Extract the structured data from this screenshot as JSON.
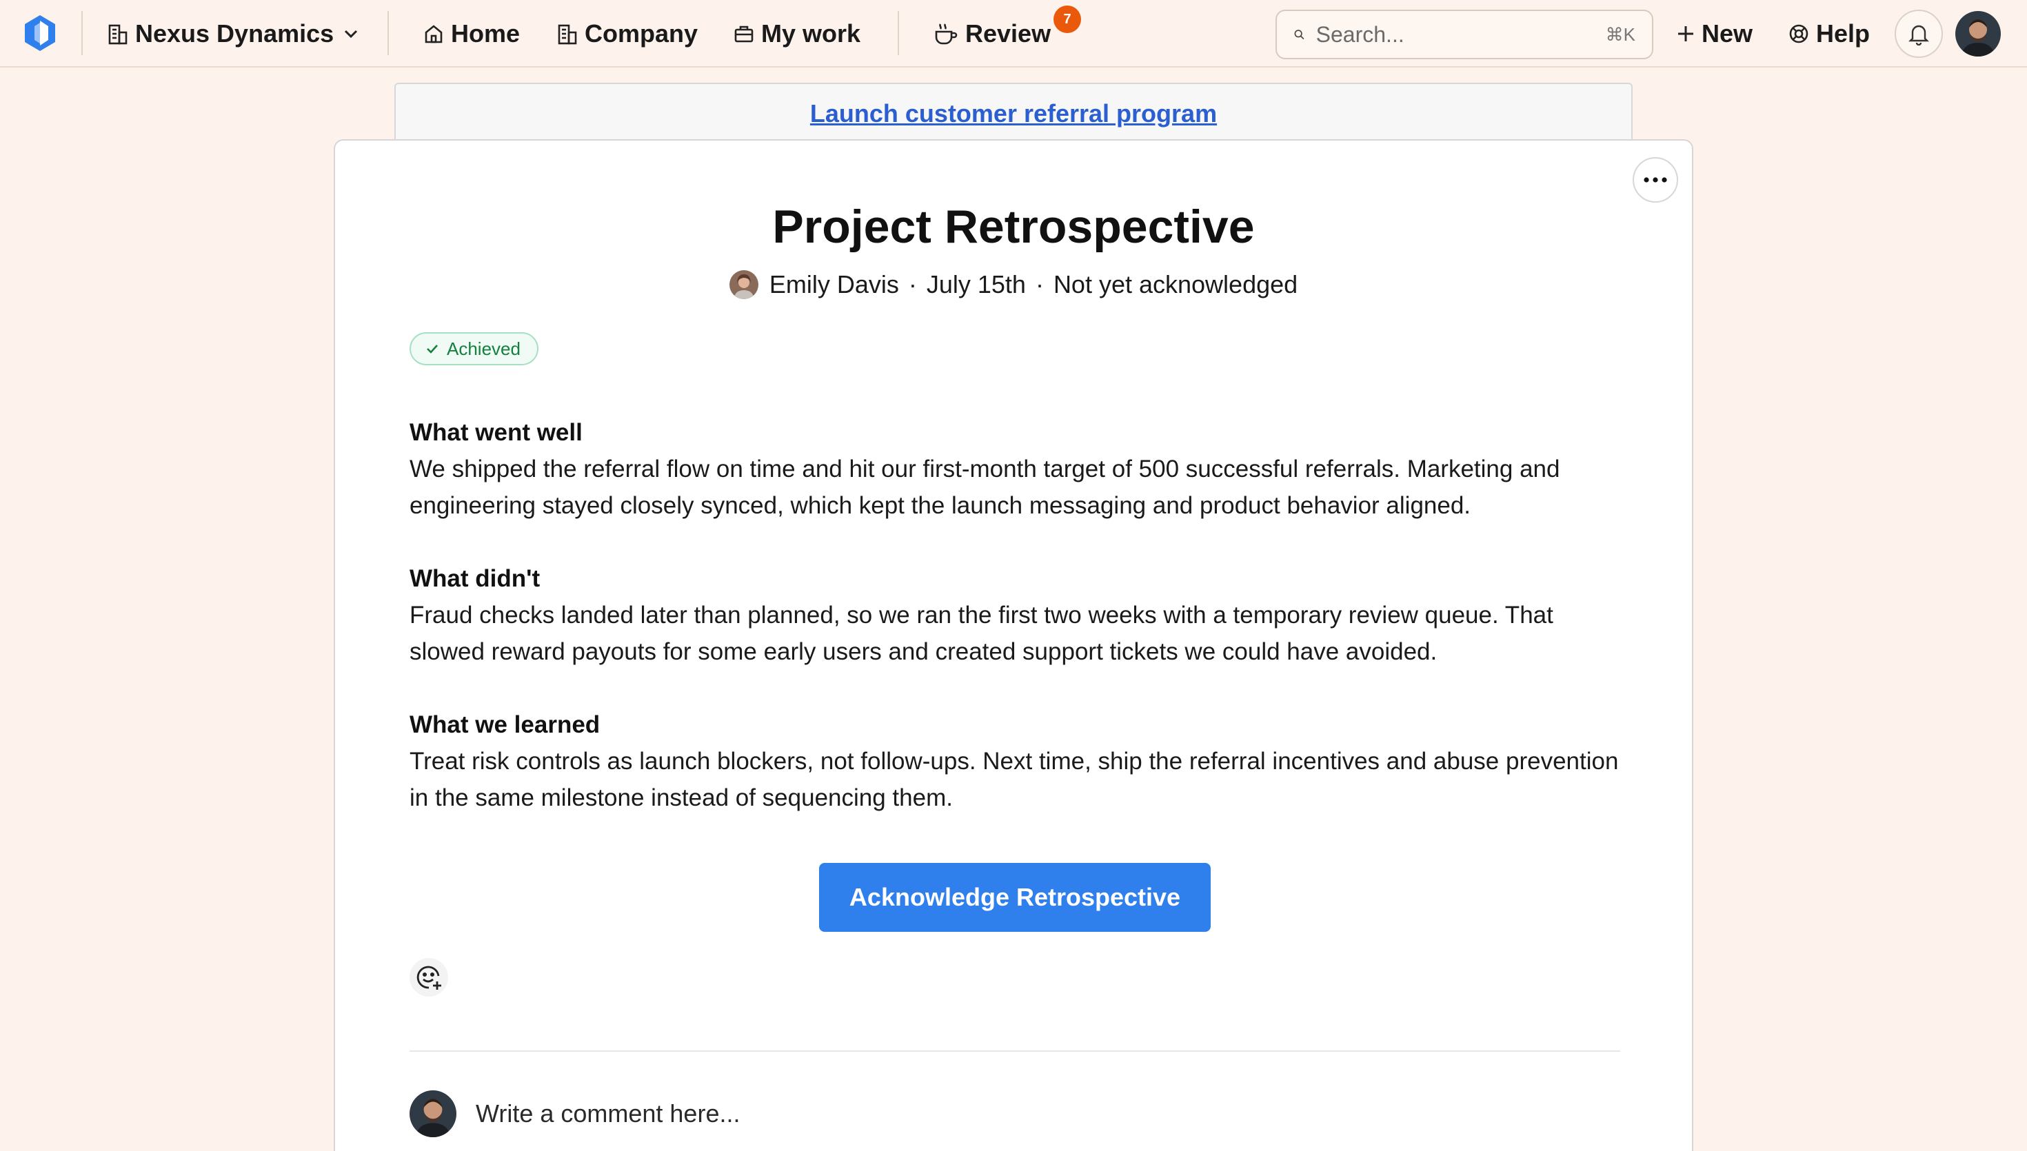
{
  "nav": {
    "company_name": "Nexus Dynamics",
    "home": "Home",
    "company": "Company",
    "my_work": "My work",
    "review": "Review",
    "review_count": "7",
    "search_placeholder": "Search...",
    "search_shortcut": "⌘K",
    "new": "New",
    "help": "Help"
  },
  "goal_link": "Launch customer referral program",
  "retro": {
    "title": "Project Retrospective",
    "author": "Emily Davis",
    "date": "July 15th",
    "ack_status": "Not yet acknowledged",
    "status": "Achieved",
    "sections": [
      {
        "heading": "What went well",
        "body": "We shipped the referral flow on time and hit our first-month target of 500 successful referrals. Marketing and engineering stayed closely synced, which kept the launch messaging and product behavior aligned."
      },
      {
        "heading": "What didn't",
        "body": "Fraud checks landed later than planned, so we ran the first two weeks with a temporary review queue. That slowed reward payouts for some early users and created support tickets we could have avoided."
      },
      {
        "heading": "What we learned",
        "body": "Treat risk controls as launch blockers, not follow-ups. Next time, ship the referral incentives and abuse prevention in the same milestone instead of sequencing them."
      }
    ],
    "ack_button": "Acknowledge Retrospective",
    "comment_placeholder": "Write a comment here..."
  },
  "colors": {
    "accent": "#2f80ed",
    "badge": "#ea580c",
    "success": "#15803d",
    "page_bg": "#fdf3ec"
  }
}
